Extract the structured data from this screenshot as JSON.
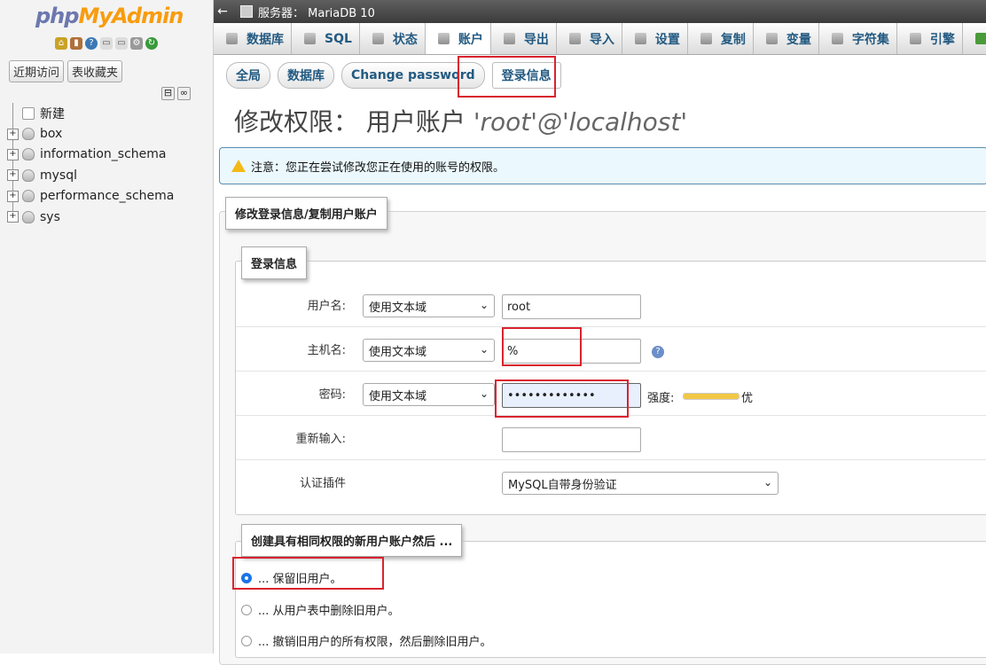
{
  "app": {
    "logo_php": "php",
    "logo_admin": "MyAdmin"
  },
  "left": {
    "recent": "近期访问",
    "favorites": "表收藏夹",
    "collapse_all": "⊟",
    "link": "∞",
    "tree": [
      {
        "name": "新建",
        "expand": ""
      },
      {
        "name": "box",
        "expand": "+"
      },
      {
        "name": "information_schema",
        "expand": "+"
      },
      {
        "name": "mysql",
        "expand": "+"
      },
      {
        "name": "performance_schema",
        "expand": "+"
      },
      {
        "name": "sys",
        "expand": "+"
      }
    ]
  },
  "server": {
    "back": "←",
    "label": "服务器： MariaDB 10"
  },
  "tabs": [
    {
      "label": "数据库"
    },
    {
      "label": "SQL"
    },
    {
      "label": "状态"
    },
    {
      "label": "账户",
      "active": true
    },
    {
      "label": "导出"
    },
    {
      "label": "导入"
    },
    {
      "label": "设置"
    },
    {
      "label": "复制"
    },
    {
      "label": "变量"
    },
    {
      "label": "字符集"
    },
    {
      "label": "引擎"
    },
    {
      "label": "插件"
    }
  ],
  "subtabs": [
    "全局",
    "数据库",
    "Change password",
    "登录信息"
  ],
  "page": {
    "title_prefix": "修改权限： 用户账户",
    "title_user": "'root'@'localhost'"
  },
  "notice": "注意：您正在尝试修改您正在使用的账号的权限。",
  "fieldset_main": {
    "legend": "修改登录信息/复制用户账户"
  },
  "login": {
    "legend": "登录信息",
    "username": {
      "label": "用户名:",
      "select": "使用文本域",
      "value": "root"
    },
    "host": {
      "label": "主机名:",
      "select": "使用文本域",
      "value": "%"
    },
    "password": {
      "label": "密码:",
      "select": "使用文本域",
      "value": "•••••••••••••",
      "strength_label": "强度:",
      "strength_value": "优"
    },
    "retype": {
      "label": "重新输入:",
      "value": ""
    },
    "auth": {
      "label": "认证插件",
      "select": "MySQL自带身份验证"
    }
  },
  "copy": {
    "legend": "创建具有相同权限的新用户账户然后 ...",
    "options": [
      {
        "label": "... 保留旧用户。",
        "selected": true
      },
      {
        "label": "... 从用户表中删除旧用户。",
        "selected": false
      },
      {
        "label": "... 撤销旧用户的所有权限，然后删除旧用户。",
        "selected": false
      }
    ]
  }
}
